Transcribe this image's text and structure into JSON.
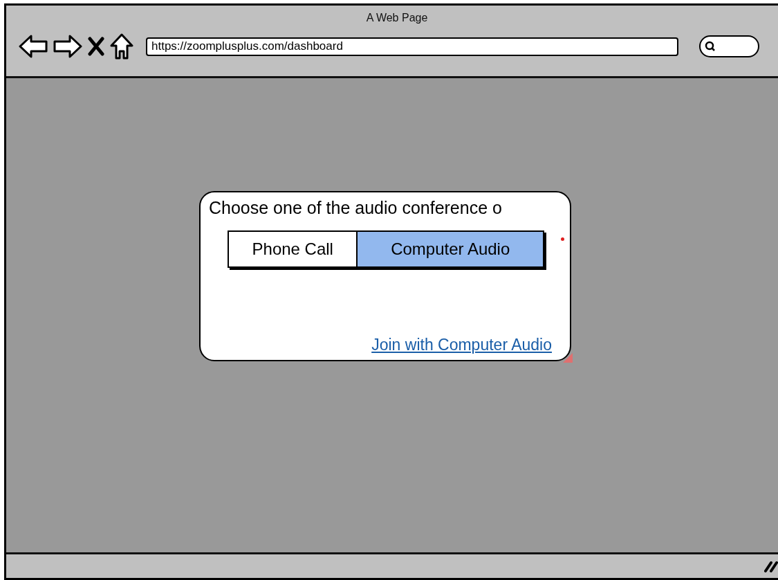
{
  "window": {
    "title": "A Web Page"
  },
  "address_bar": {
    "value": "https://zoomplusplus.com/dashboard"
  },
  "dialog": {
    "title": "Choose one of the audio conference o",
    "options": [
      {
        "label": "Phone Call",
        "selected": false
      },
      {
        "label": "Computer Audio",
        "selected": true
      }
    ],
    "link": "Join with Computer Audio"
  }
}
